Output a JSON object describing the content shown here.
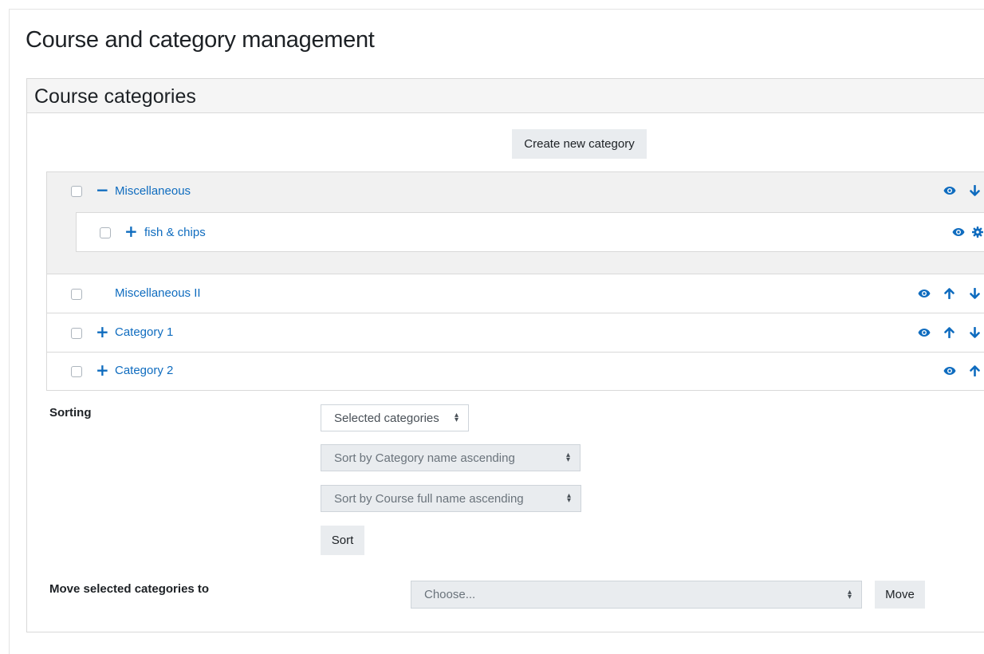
{
  "page": {
    "title": "Course and category management"
  },
  "card": {
    "title": "Course categories"
  },
  "actions": {
    "create_category": "Create new category"
  },
  "categories": [
    {
      "name": "Miscellaneous",
      "toggle": "−",
      "actions": [
        "eye-icon",
        "arrow-down-icon"
      ]
    },
    {
      "name": "fish & chips",
      "toggle": "+",
      "actions": [
        "eye-icon",
        "gear-icon"
      ]
    },
    {
      "name": "Miscellaneous II",
      "toggle": "",
      "actions": [
        "eye-icon",
        "arrow-up-icon",
        "arrow-down-icon"
      ]
    },
    {
      "name": "Category 1",
      "toggle": "+",
      "actions": [
        "eye-icon",
        "arrow-up-icon",
        "arrow-down-icon"
      ]
    },
    {
      "name": "Category 2",
      "toggle": "+",
      "actions": [
        "eye-icon",
        "arrow-up-icon"
      ]
    }
  ],
  "sorting": {
    "label": "Sorting",
    "scope_select": "Selected categories",
    "category_sort_select": "Sort by Category name ascending",
    "course_sort_select": "Sort by Course full name ascending",
    "sort_button": "Sort"
  },
  "move": {
    "label": "Move selected categories to",
    "target_select": "Choose...",
    "move_button": "Move"
  },
  "colors": {
    "link": "#0f6cbf",
    "button_bg": "#e9ecef",
    "header_bg": "#f5f5f5"
  }
}
